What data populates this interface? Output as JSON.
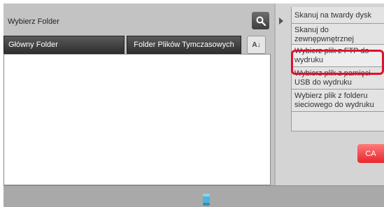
{
  "header": {
    "title": "Wybierz Folder"
  },
  "folders": {
    "main_label": "Główny Folder",
    "temp_label": "Folder Plików Tymczasowych"
  },
  "sort": {
    "label": "A↓"
  },
  "menu": {
    "items": [
      {
        "label": "Skanuj na twardy dysk"
      },
      {
        "label": "Skanuj do zewnępwnętrznej pamięci"
      },
      {
        "label": "Wybierz plik z FTP do wydruku"
      },
      {
        "label": "Wybierz plik z pamięci USB do wydruku"
      },
      {
        "label": "Wybierz plik z folderu sieciowego do wydruku"
      },
      {
        "label": ""
      }
    ],
    "selected_index": 2
  },
  "ca_button": {
    "label": "CA"
  },
  "colors": {
    "highlight": "#e1102c",
    "ca": "#e8262c",
    "storage_icon": "#4fb3d9"
  },
  "icons": {
    "search": "search-icon",
    "expand": "expand-arrow-icon",
    "storage": "storage-icon"
  }
}
